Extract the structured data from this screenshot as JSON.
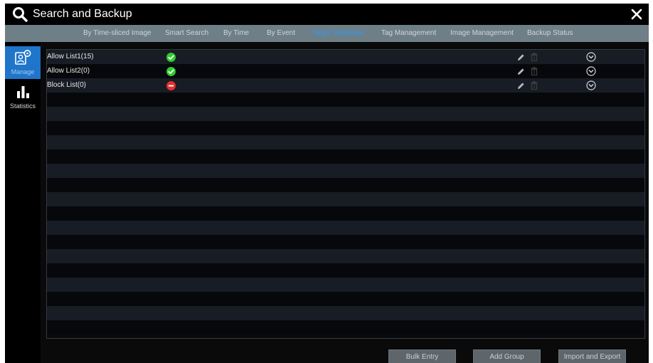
{
  "window": {
    "title": "Search and Backup",
    "close_icon": "close-icon",
    "search_icon": "search-icon"
  },
  "tabs": [
    {
      "label": "By Time-sliced Image",
      "active": false
    },
    {
      "label": "Smart Search",
      "active": false
    },
    {
      "label": "By Time",
      "active": false
    },
    {
      "label": "By Event",
      "active": false
    },
    {
      "label": "Target Database",
      "active": true
    },
    {
      "label": "Tag Management",
      "active": false
    },
    {
      "label": "Image Management",
      "active": false
    },
    {
      "label": "Backup Status",
      "active": false
    }
  ],
  "sidebar": {
    "items": [
      {
        "label": "Manage",
        "icon": "manage-icon",
        "active": true
      },
      {
        "label": "Statistics",
        "icon": "statistics-icon",
        "active": false
      }
    ]
  },
  "groups": [
    {
      "name": "Allow List1(15)",
      "status": "allow",
      "status_icon": "check-circle-icon"
    },
    {
      "name": "Allow List2(0)",
      "status": "allow",
      "status_icon": "check-circle-icon"
    },
    {
      "name": "Block List(0)",
      "status": "block",
      "status_icon": "minus-circle-icon"
    }
  ],
  "footer": {
    "bulk_entry": "Bulk Entry",
    "add_group": "Add Group",
    "import_export": "Import and Export"
  },
  "colors": {
    "accent": "#1f75c9",
    "active_tab": "#2e9af6",
    "allow_status": "#2ecc2e",
    "block_status": "#e3302e"
  }
}
